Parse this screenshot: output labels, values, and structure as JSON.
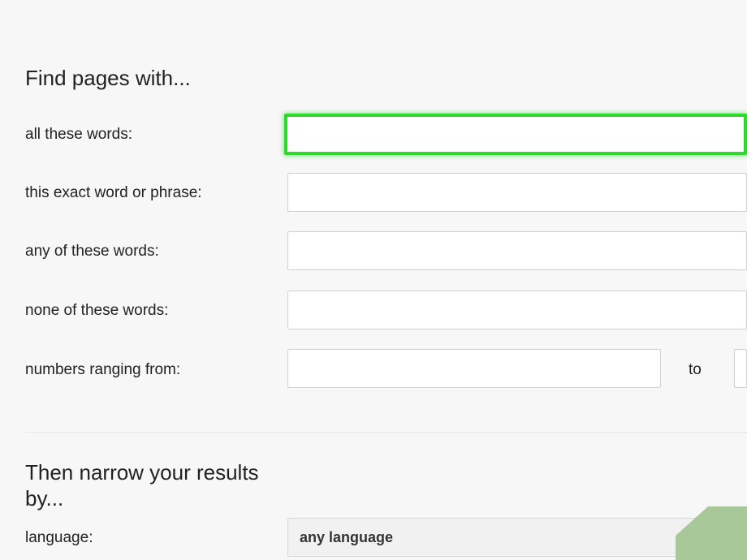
{
  "find_section": {
    "title": "Find pages with...",
    "fields": [
      {
        "label": "all these words:",
        "value": ""
      },
      {
        "label": "this exact word or phrase:",
        "value": ""
      },
      {
        "label": "any of these words:",
        "value": ""
      },
      {
        "label": "none of these words:",
        "value": ""
      }
    ],
    "range": {
      "label": "numbers ranging from:",
      "to_label": "to",
      "from_value": "",
      "to_value": ""
    }
  },
  "narrow_section": {
    "title_line1": "Then narrow your results",
    "title_line2": "by...",
    "language": {
      "label": "language:",
      "selected": "any language"
    }
  },
  "colors": {
    "focus_outline": "#2fd82f",
    "background": "#f7f7f7",
    "corner_decoration": "#a9c89a"
  }
}
